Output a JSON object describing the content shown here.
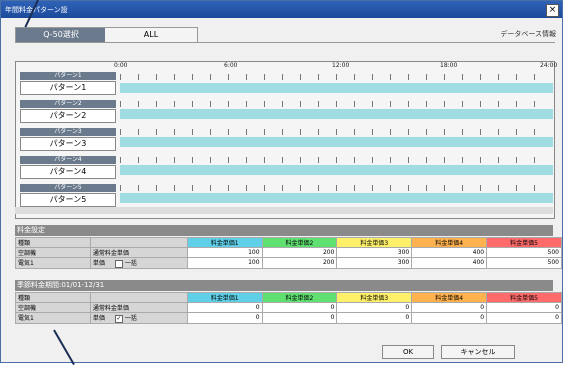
{
  "window": {
    "title": "年間料金パターン設",
    "close_label": "×"
  },
  "tabs": [
    {
      "label": "Q-50選択"
    },
    {
      "label": "ALL"
    }
  ],
  "db_info": "データベース情報",
  "timeline": {
    "ticks": [
      "0:00",
      "6:00",
      "12:00",
      "18:00",
      "24:00"
    ]
  },
  "patterns": [
    {
      "label": "パターン1",
      "button": "パターン1"
    },
    {
      "label": "パターン2",
      "button": "パターン2"
    },
    {
      "label": "パターン3",
      "button": "パターン3"
    },
    {
      "label": "パターン4",
      "button": "パターン4"
    },
    {
      "label": "パターン5",
      "button": "パターン5"
    }
  ],
  "rate_setting": {
    "title": "料金設定",
    "header": {
      "kind": "種類",
      "cols": [
        "料金単価1",
        "料金単価2",
        "料金単価3",
        "料金単価4",
        "料金単価5"
      ]
    },
    "rows": [
      {
        "name": "空調機",
        "type": "通常料金単価",
        "check": "",
        "values": [
          "100",
          "200",
          "300",
          "400",
          "500"
        ]
      },
      {
        "name": "電気1",
        "type": "単価",
        "check": "一括",
        "values": [
          "100",
          "200",
          "300",
          "400",
          "500"
        ]
      }
    ]
  },
  "seasonal": {
    "title": "季節料金期間:01/01-12/31",
    "header": {
      "kind": "種類",
      "cols": [
        "料金単価1",
        "料金単価2",
        "料金単価3",
        "料金単価4",
        "料金単価5"
      ]
    },
    "rows": [
      {
        "name": "空調機",
        "type": "通常料金単価",
        "check": "",
        "values": [
          "0",
          "0",
          "0",
          "0",
          "0"
        ]
      },
      {
        "name": "電気1",
        "type": "単価",
        "check": "一括",
        "checked": "✓",
        "values": [
          "0",
          "0",
          "0",
          "0",
          "0"
        ]
      }
    ]
  },
  "buttons": {
    "ok": "OK",
    "cancel": "キャンセル"
  }
}
